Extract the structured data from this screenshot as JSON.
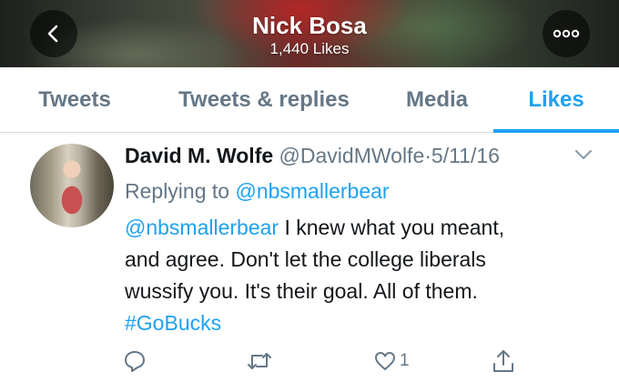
{
  "header": {
    "title": "Nick Bosa",
    "subtitle": "1,440 Likes",
    "back_icon": "chevron-left-icon",
    "more_icon": "more-dots-icon"
  },
  "tabs": [
    {
      "label": "Tweets",
      "active": false
    },
    {
      "label": "Tweets & replies",
      "active": false
    },
    {
      "label": "Media",
      "active": false
    },
    {
      "label": "Likes",
      "active": true
    }
  ],
  "tweet": {
    "author_name": "David M. Wolfe",
    "handle": "@DavidMWolfe",
    "separator": "·",
    "date": "5/11/16",
    "replying_prefix": "Replying to",
    "replying_handle": "@nbsmallerbear",
    "body": {
      "mention": "@nbsmallerbear",
      "line1_rest": " I knew what you meant,",
      "line2": "and agree. Don't let the college liberals",
      "line3": "wussify you. It's their goal. All of them.",
      "hashtag": "#GoBucks"
    },
    "actions": {
      "reply_icon": "reply-icon",
      "retweet_icon": "retweet-icon",
      "like_icon": "heart-icon",
      "like_count": "1",
      "share_icon": "share-icon"
    }
  },
  "colors": {
    "accent": "#1da1f2",
    "muted": "#657786",
    "text": "#14171a",
    "divider": "#d8dde2"
  }
}
